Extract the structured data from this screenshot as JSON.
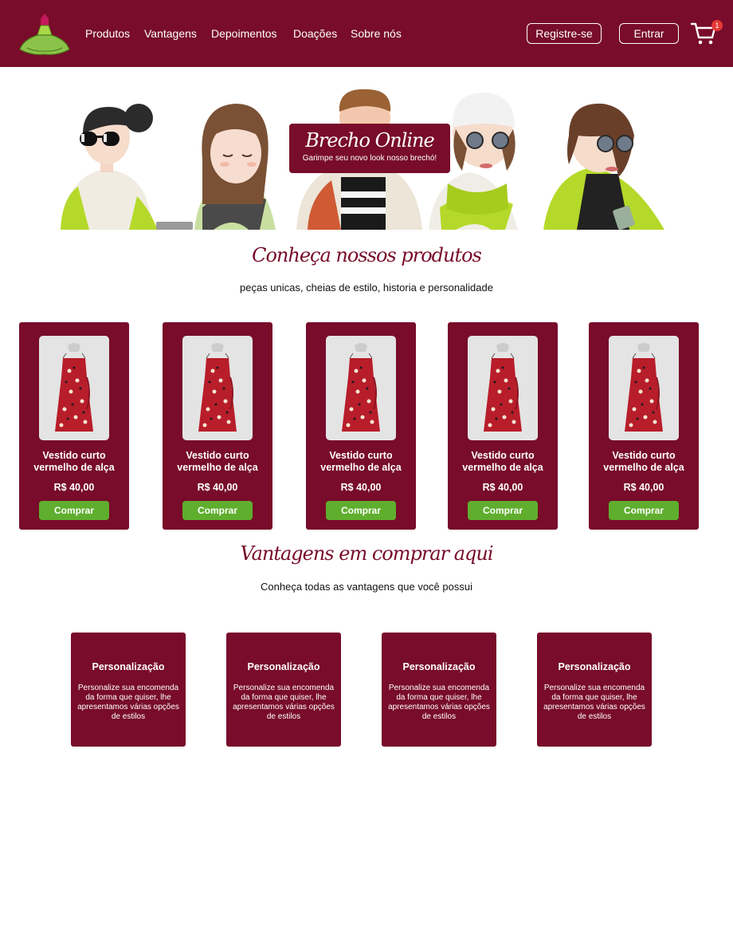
{
  "header": {
    "nav": [
      "Produtos",
      "Vantagens",
      "Depoimentos",
      "Doações",
      "Sobre nós"
    ],
    "register_label": "Registre-se",
    "login_label": "Entrar",
    "cart_count": "1",
    "logo_icon": "dress-logo-icon",
    "cart_icon": "cart-icon"
  },
  "hero": {
    "title": "Brecho Online",
    "subtitle": "Garimpe seu novo look nosso brechó!"
  },
  "products_section": {
    "title": "Conheça nossos produtos",
    "subtitle": "peças unicas, cheias de estilo, historia e personalidade"
  },
  "products": [
    {
      "name": "Vestido curto vermelho de alça",
      "price": "R$ 40,00",
      "button": "Comprar"
    },
    {
      "name": "Vestido curto vermelho de alça",
      "price": "R$ 40,00",
      "button": "Comprar"
    },
    {
      "name": "Vestido curto vermelho de alça",
      "price": "R$ 40,00",
      "button": "Comprar"
    },
    {
      "name": "Vestido curto vermelho de alça",
      "price": "R$ 40,00",
      "button": "Comprar"
    },
    {
      "name": "Vestido curto vermelho de alça",
      "price": "R$ 40,00",
      "button": "Comprar"
    }
  ],
  "advantages_section": {
    "title": "Vantagens em comprar aqui",
    "subtitle": "Conheça todas as vantagens que você possui"
  },
  "advantages": [
    {
      "title": "Personalização",
      "text": "Personalize sua encomenda da forma que quiser, lhe apresentamos várias opções de estilos"
    },
    {
      "title": "Personalização",
      "text": "Personalize sua encomenda da forma que quiser, lhe apresentamos várias opções de estilos"
    },
    {
      "title": "Personalização",
      "text": "Personalize sua encomenda da forma que quiser, lhe apresentamos várias opções de estilos"
    },
    {
      "title": "Personalização",
      "text": "Personalize sua encomenda da forma que quiser, lhe apresentamos várias opções de estilos"
    }
  ],
  "colors": {
    "brand": "#780c2a",
    "buy_button": "#5fae2e",
    "badge": "#e53935"
  }
}
